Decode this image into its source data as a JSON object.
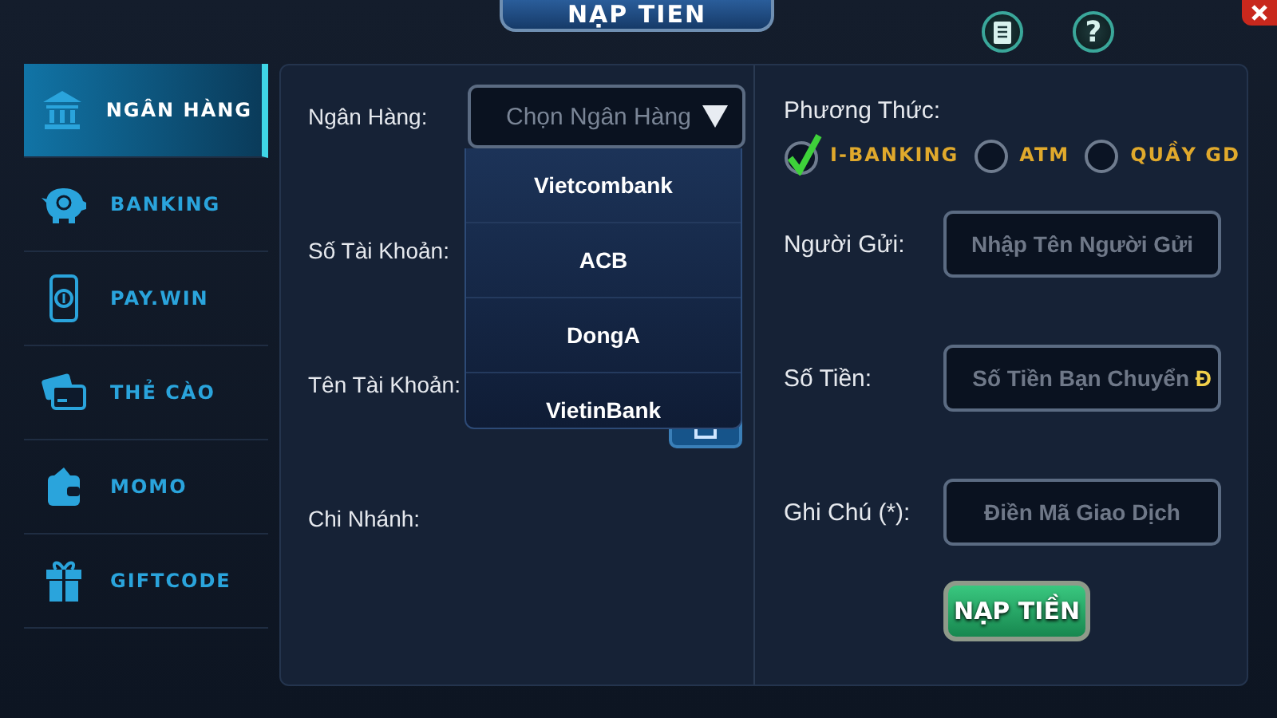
{
  "header": {
    "title": "NẠP TIEN",
    "help_button": "?"
  },
  "sidebar": {
    "items": [
      {
        "label": "NGÂN HÀNG",
        "selected": true
      },
      {
        "label": "BANKING",
        "selected": false
      },
      {
        "label": "PAY.WIN",
        "selected": false
      },
      {
        "label": "THẺ CÀO",
        "selected": false
      },
      {
        "label": "MOMO",
        "selected": false
      },
      {
        "label": "GIFTCODE",
        "selected": false
      }
    ]
  },
  "left_form": {
    "bank_label": "Ngân Hàng:",
    "bank_select": {
      "placeholder": "Chọn Ngân Hàng",
      "expanded": true,
      "options": [
        "Vietcombank",
        "ACB",
        "DongA",
        "VietinBank"
      ]
    },
    "fields": [
      {
        "label": "Số Tài Khoản:"
      },
      {
        "label": "Tên Tài Khoản:"
      },
      {
        "label": "Chi Nhánh:"
      }
    ]
  },
  "right_form": {
    "method_label": "Phương Thức:",
    "methods": [
      {
        "label": "I-BANKING",
        "selected": true
      },
      {
        "label": "ATM",
        "selected": false
      },
      {
        "label": "QUẦY GD",
        "selected": false
      }
    ],
    "fields": [
      {
        "label": "Người Gửi:",
        "placeholder": "Nhập Tên Người Gửi"
      },
      {
        "label": "Số Tiền:",
        "placeholder": "Số Tiền Bạn Chuyển",
        "suffix": "Đ"
      },
      {
        "label": "Ghi Chú (*):",
        "placeholder": "Điền Mã Giao Dịch"
      }
    ],
    "submit": "NẠP TIỀN"
  }
}
